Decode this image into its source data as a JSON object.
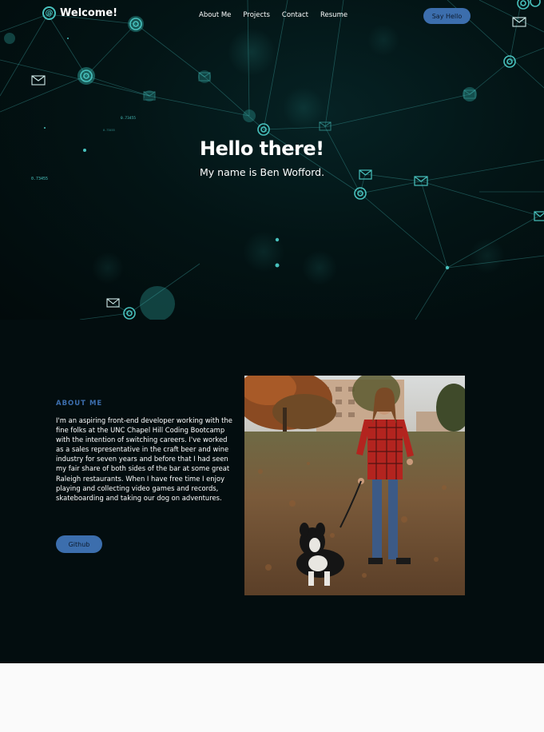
{
  "nav": {
    "brand": "Welcome!",
    "brand_icon": "at-sign-icon",
    "links": [
      {
        "label": "About Me"
      },
      {
        "label": "Projects"
      },
      {
        "label": "Contact"
      },
      {
        "label": "Resume"
      }
    ],
    "cta_label": "Say Hello"
  },
  "hero": {
    "title": "Hello there!",
    "subtitle": "My name is Ben Wofford.",
    "floating_numbers": [
      "0.73455",
      "0.73455",
      "0.73455"
    ]
  },
  "about": {
    "heading": "ABOUT ME",
    "body": "I'm an aspiring front-end developer working with the fine folks at the UNC Chapel Hill Coding Bootcamp with the intention of switching careers. I've worked as a sales representative in the craft beer and wine industry for seven years and before that I had seen my fair share of both sides of the bar at some great Raleigh restaurants. When I have free time I enjoy playing and collecting video games and records, skateboarding and taking our dog on adventures.",
    "button_label": "Github",
    "photo": "photo-of-man-with-dog"
  },
  "colors": {
    "accent": "#3c6ead",
    "teal": "#48c1bd",
    "hero_bg": "#020a0b",
    "about_bg": "#030d0f"
  }
}
